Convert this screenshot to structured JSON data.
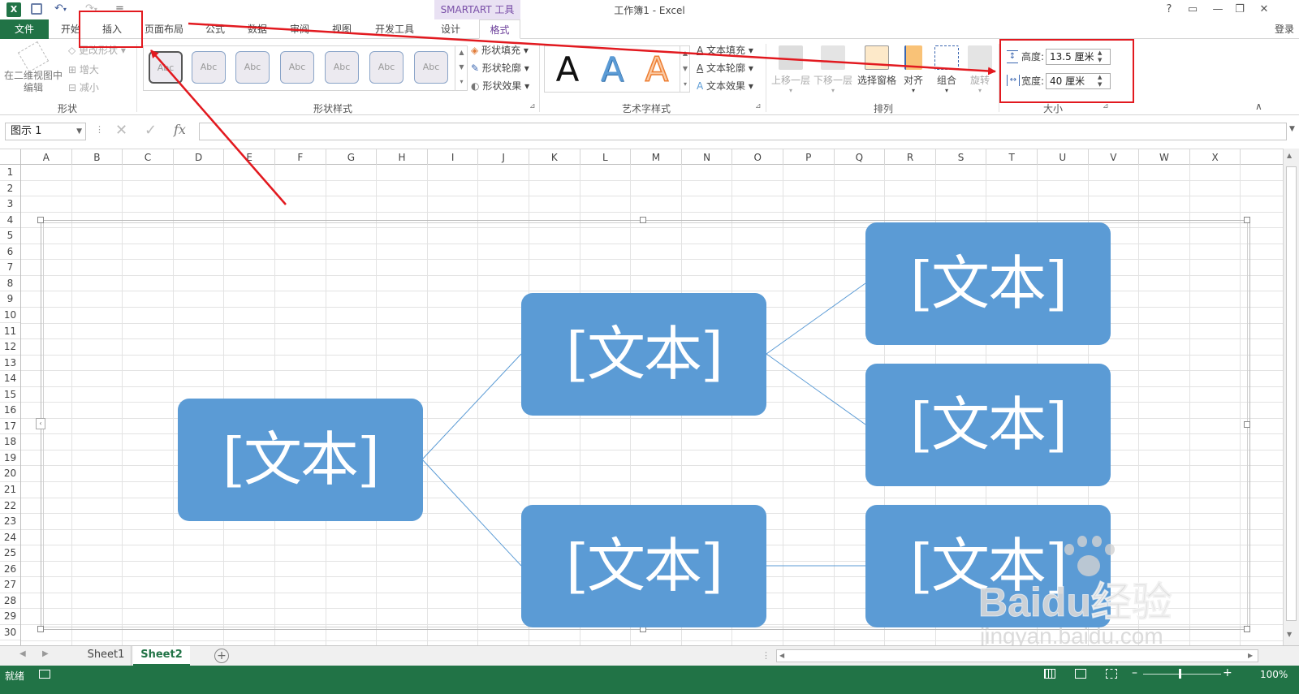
{
  "window": {
    "title": "工作簿1 - Excel",
    "context_group": "SMARTART 工具",
    "help": "?",
    "login": "登录"
  },
  "tabs": {
    "file": "文件",
    "home": "开始",
    "insert": "插入",
    "page_layout": "页面布局",
    "formulas": "公式",
    "data": "数据",
    "review": "审阅",
    "view": "视图",
    "developer": "开发工具",
    "design": "设计",
    "format": "格式"
  },
  "ribbon": {
    "shapes": {
      "edit_2d": "在二维视图中编辑",
      "change_shape": "更改形状",
      "larger": "增大",
      "smaller": "减小",
      "label": "形状"
    },
    "shape_styles": {
      "sample": "Abc",
      "fill": "形状填充",
      "outline": "形状轮廓",
      "effects": "形状效果",
      "label": "形状样式"
    },
    "wordart": {
      "letter": "A",
      "text_fill": "文本填充",
      "text_outline": "文本轮廓",
      "text_effects": "文本效果",
      "label": "艺术字样式"
    },
    "arrange": {
      "bring_forward": "上移一层",
      "send_backward": "下移一层",
      "selection_pane": "选择窗格",
      "align": "对齐",
      "group": "组合",
      "rotate": "旋转",
      "label": "排列"
    },
    "size": {
      "height_label": "高度:",
      "height_value": "13.5 厘米",
      "width_label": "宽度:",
      "width_value": "40 厘米",
      "label": "大小"
    }
  },
  "formula_bar": {
    "name_box": "图示 1",
    "fx": "fx"
  },
  "columns": [
    "A",
    "B",
    "C",
    "D",
    "E",
    "F",
    "G",
    "H",
    "I",
    "J",
    "K",
    "L",
    "M",
    "N",
    "O",
    "P",
    "Q",
    "R",
    "S",
    "T",
    "U",
    "V",
    "W",
    "X"
  ],
  "rows": [
    "1",
    "2",
    "3",
    "4",
    "5",
    "6",
    "7",
    "8",
    "9",
    "10",
    "11",
    "12",
    "13",
    "14",
    "15",
    "16",
    "17",
    "18",
    "19",
    "20",
    "21",
    "22",
    "23",
    "24",
    "25",
    "26",
    "27",
    "28",
    "29",
    "30"
  ],
  "smartart": {
    "node_text": "[文本]"
  },
  "sheets": [
    "Sheet1",
    "Sheet2"
  ],
  "status": {
    "ready": "就绪",
    "zoom": "100%"
  },
  "watermark": {
    "brand": "Baidu经验",
    "url": "jingyan.baidu.com"
  },
  "colors": {
    "excel_green": "#217346",
    "node_blue": "#5b9bd5",
    "annotation_red": "#e2191f",
    "context_purple": "#7a4fa8"
  }
}
